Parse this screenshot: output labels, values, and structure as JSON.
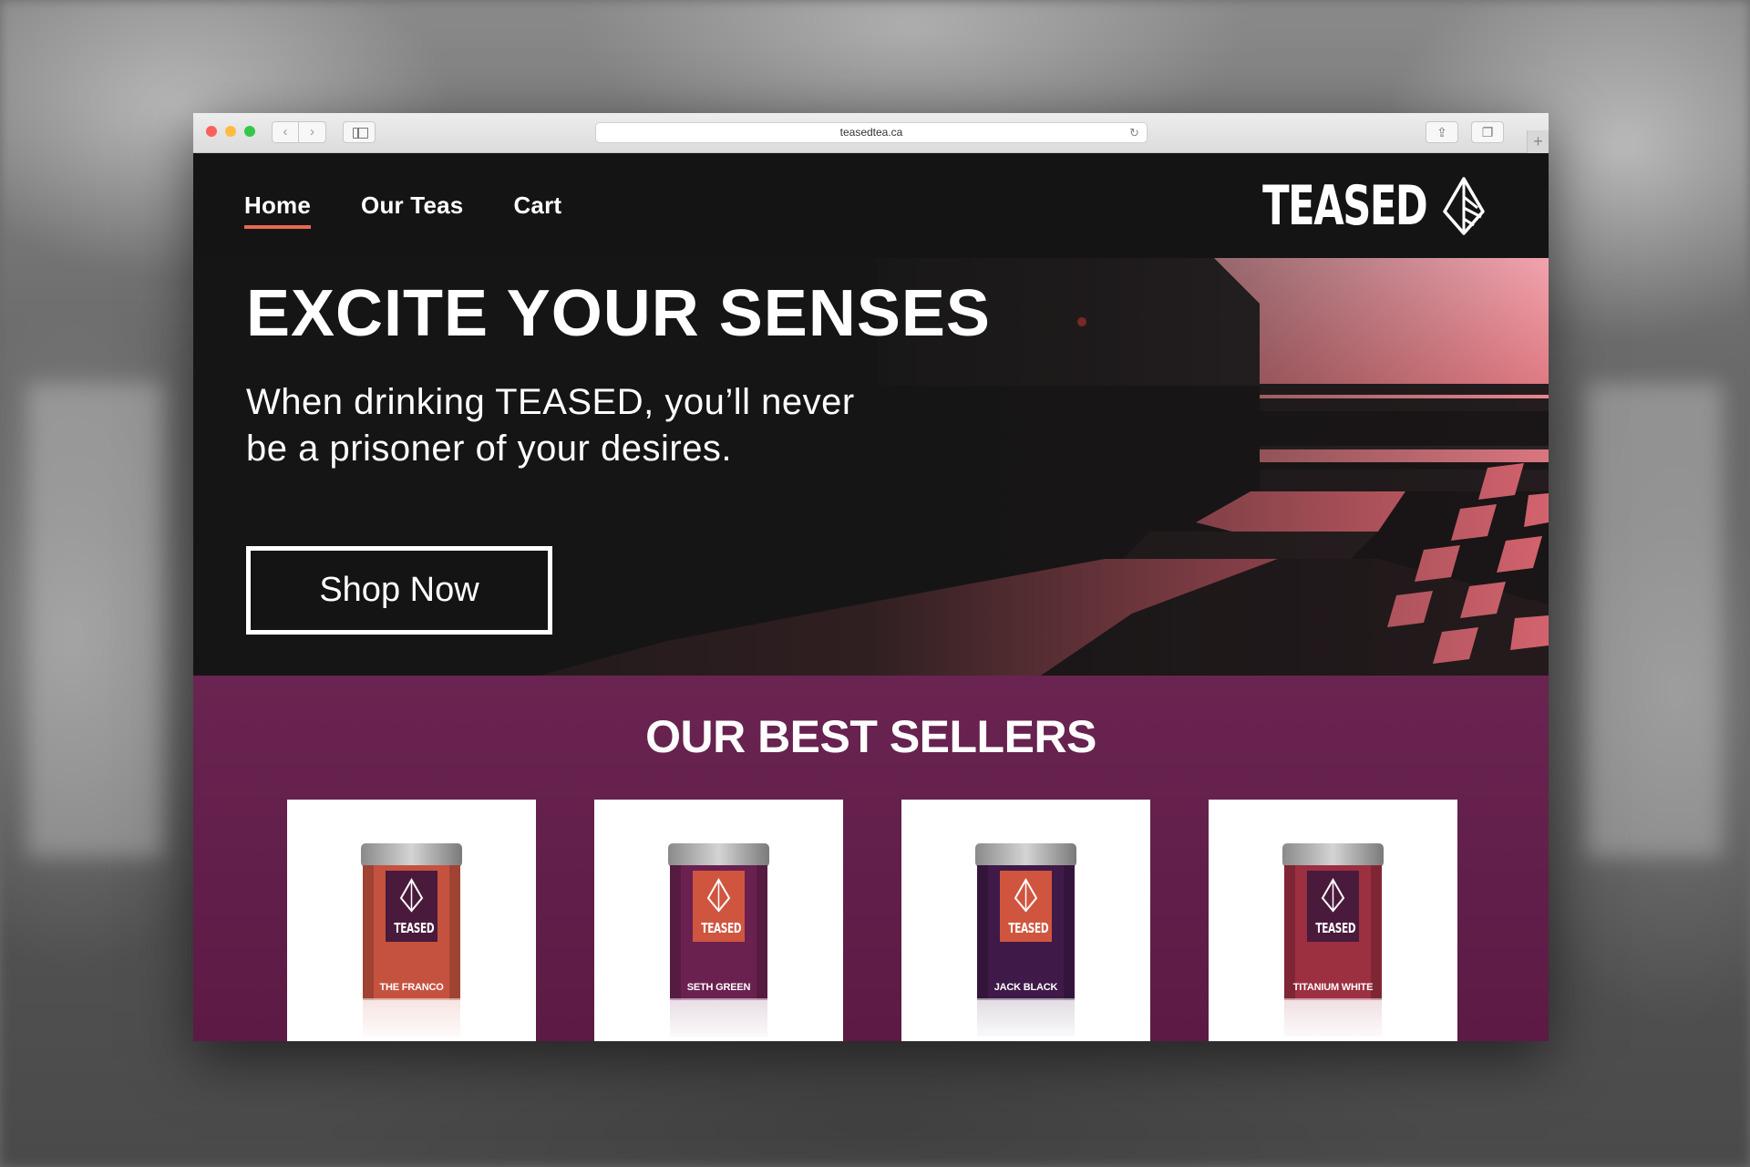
{
  "browser": {
    "url": "teasedtea.ca",
    "new_tab": "+",
    "back": "‹",
    "forward": "›",
    "reload": "↻",
    "share": "⇪",
    "tabs": "❐"
  },
  "nav": {
    "items": [
      {
        "label": "Home",
        "active": true
      },
      {
        "label": "Our Teas",
        "active": false
      },
      {
        "label": "Cart",
        "active": false
      }
    ]
  },
  "brand": {
    "wordmark": "TEASED",
    "icon": "diamond-leaf-icon"
  },
  "hero": {
    "title": "EXCITE YOUR SENSES",
    "subtitle": "When drinking TEASED, you’ll never be a prisoner of your desires.",
    "cta": "Shop Now"
  },
  "best_sellers": {
    "title": "OUR BEST SELLERS",
    "products": [
      {
        "name": "THE FRANCO",
        "tin_color": "#c5523f",
        "label_color": "#4a1a3c",
        "symbol": "triangle-down"
      },
      {
        "name": "SETH GREEN",
        "tin_color": "#6a2150",
        "label_color": "#d0553f",
        "symbol": "triangle-down"
      },
      {
        "name": "JACK BLACK",
        "tin_color": "#3f1a48",
        "label_color": "#d0553f",
        "symbol": "triangle-up"
      },
      {
        "name": "TITANIUM WHITE",
        "tin_color": "#9c2f40",
        "label_color": "#4a1a3c",
        "symbol": "triangle-up"
      }
    ]
  },
  "colors": {
    "accent": "#e86a4f",
    "header_bg": "#141414",
    "sellers_bg": "#6a2451"
  }
}
